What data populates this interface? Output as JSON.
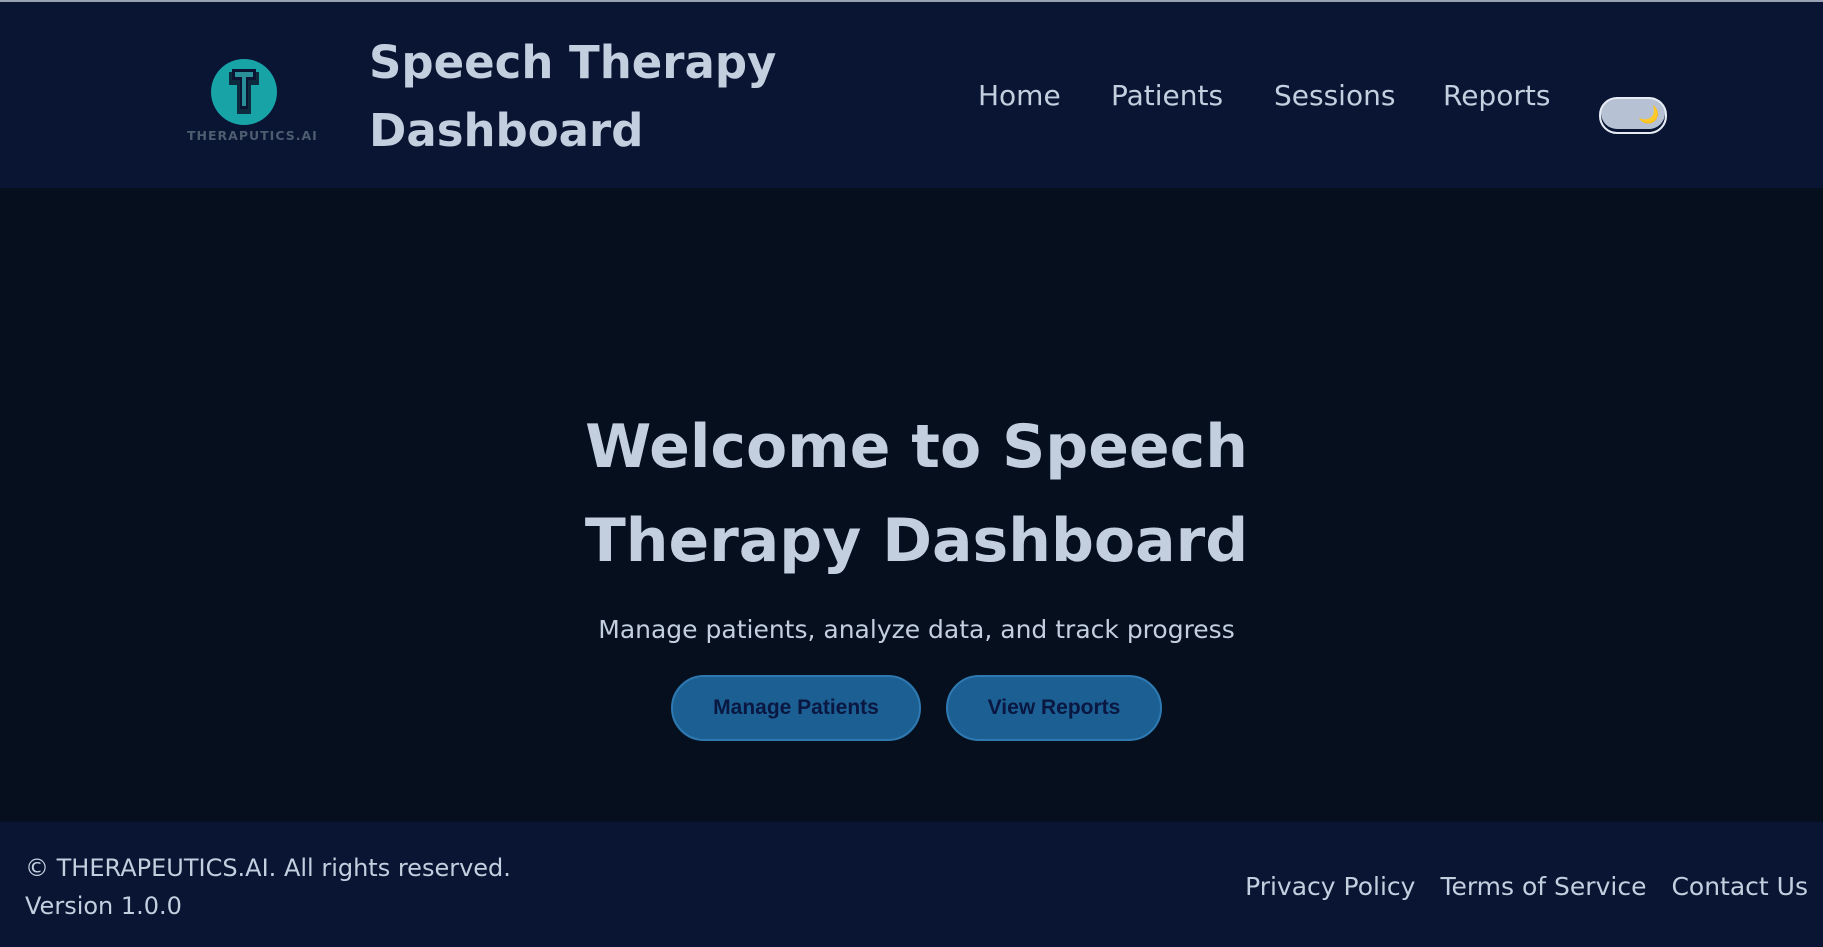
{
  "header": {
    "logo_text": "THERAPUTICS.AI",
    "logo_icon": "letter-t-logo",
    "title": "Speech Therapy Dashboard",
    "nav": [
      {
        "label": "Home"
      },
      {
        "label": "Patients"
      },
      {
        "label": "Sessions"
      },
      {
        "label": "Reports"
      }
    ],
    "theme_toggle_icon": "moon-icon",
    "theme_toggle_glyph": "🌙"
  },
  "hero": {
    "title": "Welcome to Speech Therapy Dashboard",
    "subtitle": "Manage patients, analyze data, and track progress",
    "primary_button": "Manage Patients",
    "secondary_button": "View Reports"
  },
  "footer": {
    "copyright": "© THERAPEUTICS.AI. All rights reserved.",
    "version": "Version 1.0.0",
    "links": [
      {
        "label": "Privacy Policy"
      },
      {
        "label": "Terms of Service"
      },
      {
        "label": "Contact Us"
      }
    ]
  },
  "colors": {
    "header_bg": "#0a1433",
    "body_bg": "#050f1d",
    "text": "#c3cfdf",
    "logo_teal": "#18a3a6",
    "button_bg": "#1c5f93",
    "button_text": "#0a1740"
  }
}
